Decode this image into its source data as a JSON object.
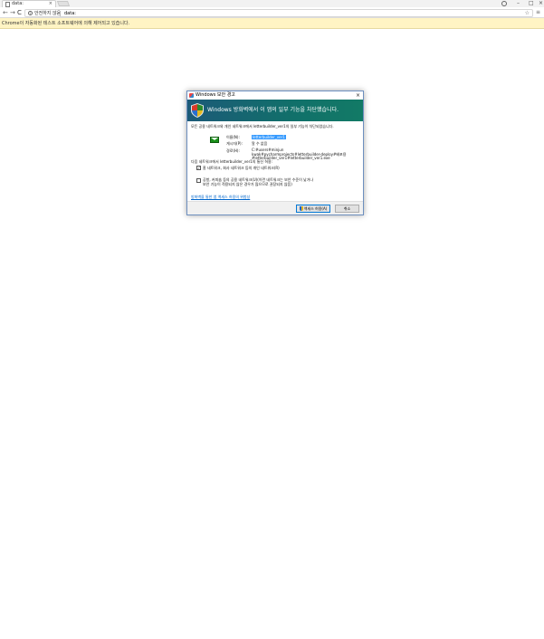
{
  "browser": {
    "tab_title": "data:",
    "tab_close": "×",
    "window_controls": {
      "minimize": "–",
      "maximize": "□",
      "close": "×"
    },
    "nav": {
      "back": "←",
      "forward": "→",
      "reload": "C"
    },
    "omnibox": {
      "security_status": "안전하지 않음",
      "url": "data:"
    },
    "star": "☆",
    "menu": "≡"
  },
  "infobar": {
    "text": "Chrome이 자동화된 테스트 소프트웨어에 의해 제어되고 있습니다."
  },
  "dialog": {
    "title": "Windows 보안 경고",
    "close": "×",
    "banner": "Windows 방화벽에서 이 앱의 일부 기능을 차단했습니다.",
    "intro": "모든 공용 네트워크와 개인 네트워크에서 letterbuilder_ver1의 일부 기능이 차단되었습니다.",
    "fields": [
      {
        "label": "이름(N):",
        "value": "letterbuilder_ver1"
      },
      {
        "label": "게시자(P):",
        "value": "알 수 없음"
      },
      {
        "label": "경로(H):",
        "value": "C:#users#minjun kwak#pycharmprojects#letterbuilder-deploy#배포용#letterbuilder_ver1#letterbuilder_ver1.exe"
      }
    ],
    "allow_label": "다음 네트워크에서 letterbuilder_ver1의 통신 허용:",
    "options": [
      {
        "checked": true,
        "label": "홈 네트워크, 회사 네트워크 등의 개인 네트워크(R)"
      },
      {
        "checked": false,
        "label_line1": "공항, 커피숍 등의 공용 네트워크(U)(이런 네트워크는 보안 수준이 낮거나",
        "label_line2": "보안 기능이 적용되지 않은 경우가 많으므로 권장되지 않음)"
      }
    ],
    "link": "방화벽을 통한 앱 액세스 허용의 위험성",
    "buttons": {
      "allow": "액세스 허용(A)",
      "cancel": "취소"
    }
  },
  "colors": {
    "banner": "#11706a",
    "infobar": "#fff4c4",
    "link": "#0066cc"
  }
}
